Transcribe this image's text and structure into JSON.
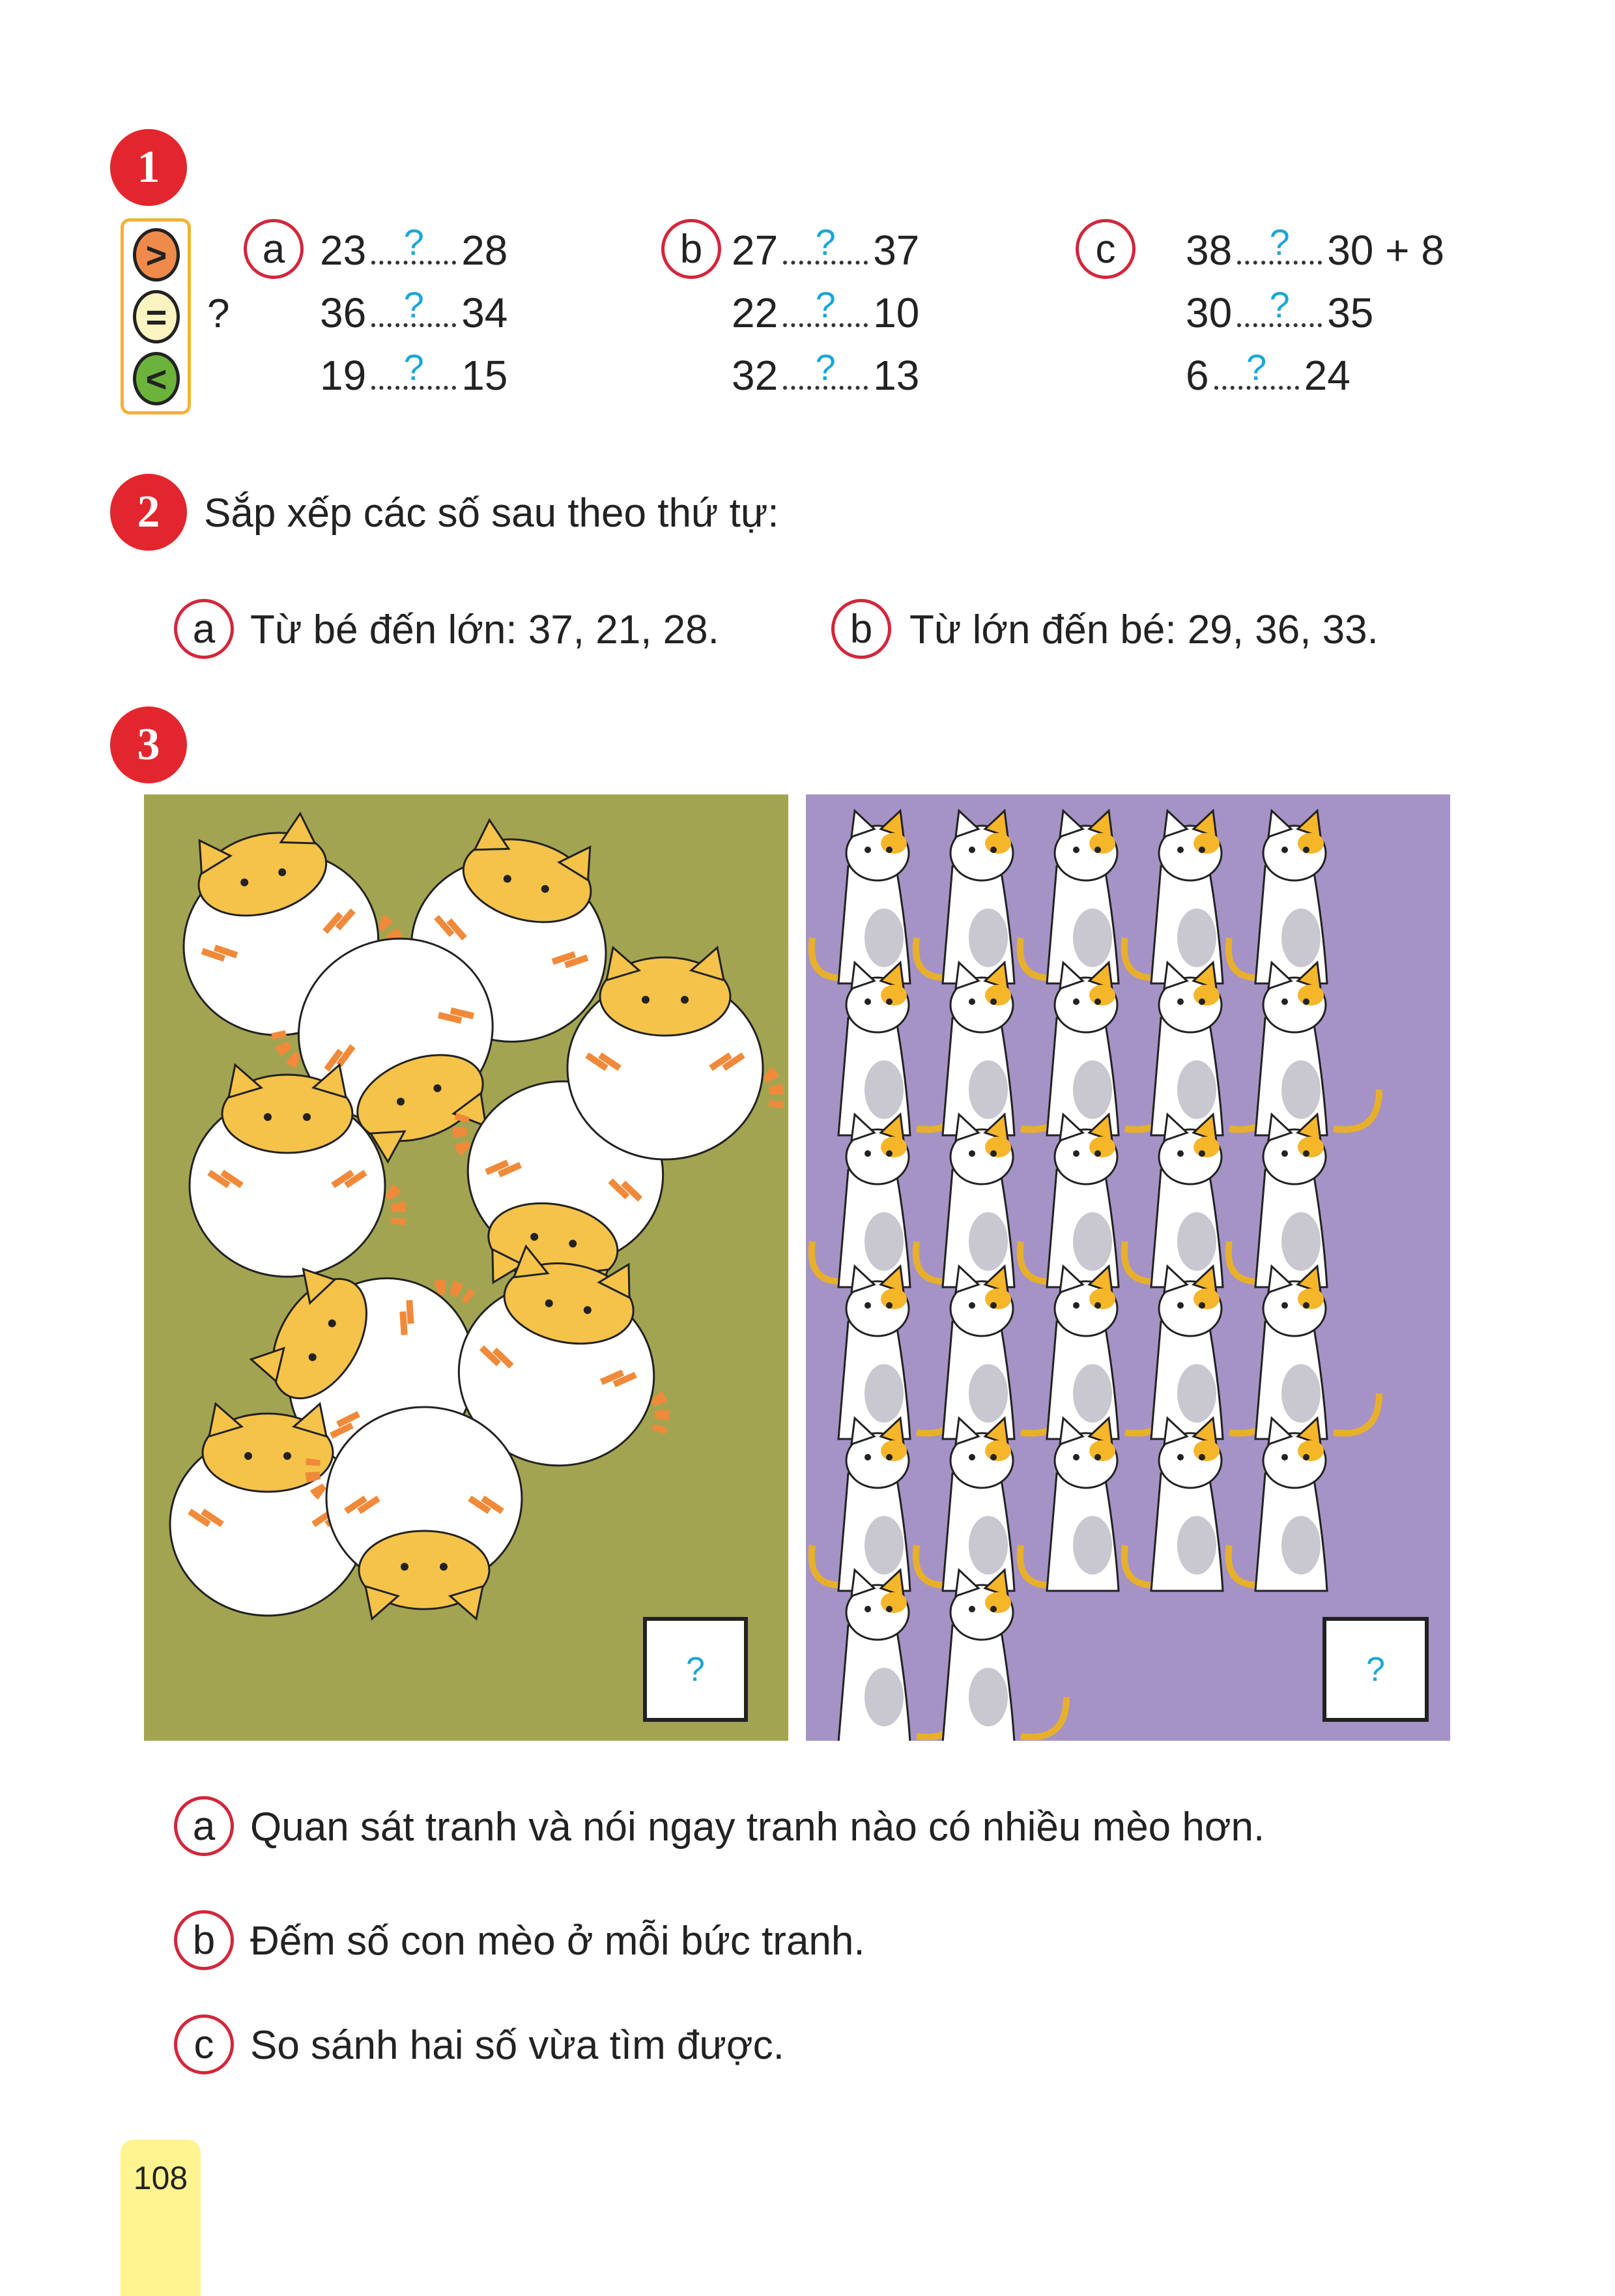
{
  "exercise1": {
    "number": "1",
    "symbols": [
      ">",
      "=",
      "<"
    ],
    "symbol_colors": [
      "#f08a4b",
      "#fbf3c0",
      "#6bb33a"
    ],
    "prompt_mark": "?",
    "columns": [
      {
        "label": "a",
        "items": [
          {
            "left": "23",
            "blank": "?",
            "right": "28"
          },
          {
            "left": "36",
            "blank": "?",
            "right": "34"
          },
          {
            "left": "19",
            "blank": "?",
            "right": "15"
          }
        ]
      },
      {
        "label": "b",
        "items": [
          {
            "left": "27",
            "blank": "?",
            "right": "37"
          },
          {
            "left": "22",
            "blank": "?",
            "right": "10"
          },
          {
            "left": "32",
            "blank": "?",
            "right": "13"
          }
        ]
      },
      {
        "label": "c",
        "items": [
          {
            "left": "38",
            "blank": "?",
            "right": "30 + 8"
          },
          {
            "left": "30",
            "blank": "?",
            "right": "35"
          },
          {
            "left": "6",
            "blank": "?",
            "right": "24"
          }
        ]
      }
    ]
  },
  "exercise2": {
    "number": "2",
    "instruction": "Sắp xếp các số sau theo thứ tự:",
    "parts": [
      {
        "label": "a",
        "text": "Từ bé đến lớn: 37, 21, 28."
      },
      {
        "label": "b",
        "text": "Từ lớn đến bé: 29, 36, 33."
      }
    ]
  },
  "exercise3": {
    "number": "3",
    "pictures": [
      {
        "background": "#a3a452",
        "answer": "?"
      },
      {
        "background": "#a593c6",
        "answer": "?"
      }
    ],
    "questions": [
      {
        "label": "a",
        "text": "Quan sát tranh và nói ngay tranh nào có nhiều mèo hơn."
      },
      {
        "label": "b",
        "text": "Đếm số con mèo ở mỗi bức tranh."
      },
      {
        "label": "c",
        "text": "So sánh hai số vừa tìm được."
      }
    ]
  },
  "page_number": "108",
  "colors": {
    "badge": "#e3262d",
    "label_ring": "#d3263a",
    "question_mark": "#19a6d8",
    "page_tab": "#fff48f"
  }
}
